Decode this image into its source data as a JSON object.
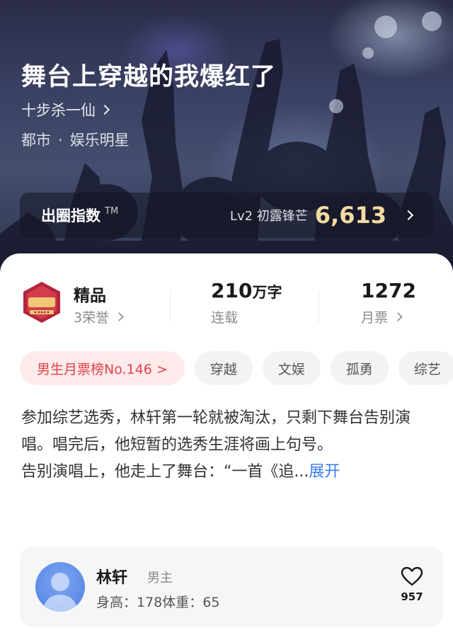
{
  "book": {
    "title": "舞台上穿越的我爆红了",
    "author": "十步杀一仙",
    "genre_main": "都市",
    "genre_sub": "娱乐明星"
  },
  "index": {
    "label": "出圈指数",
    "tm": "TM",
    "level": "Lv2 初露锋芒",
    "value": "6,613"
  },
  "stats": {
    "quality_title": "精品",
    "quality_sub": "3荣誉",
    "words_num": "210",
    "words_unit": "万字",
    "words_sub": "连载",
    "tickets_num": "1272",
    "tickets_sub": "月票"
  },
  "tags": [
    "男生月票榜No.146 >",
    "穿越",
    "文娱",
    "孤勇",
    "综艺"
  ],
  "synopsis": {
    "text": "参加综艺选秀，林轩第一轮就被淘汰，只剩下舞台告别演唱。唱完后，他短暂的选秀生涯将画上句号。\n告别演唱上，他走上了舞台：“一首《追...",
    "more": "展开"
  },
  "character": {
    "name": "林轩",
    "role": "男主",
    "desc": "身高：178体重：65",
    "likes": "957"
  },
  "colors": {
    "accent_gold": "#f3dba2",
    "rank_red": "#e0434b",
    "link_blue": "#3b7df5"
  }
}
